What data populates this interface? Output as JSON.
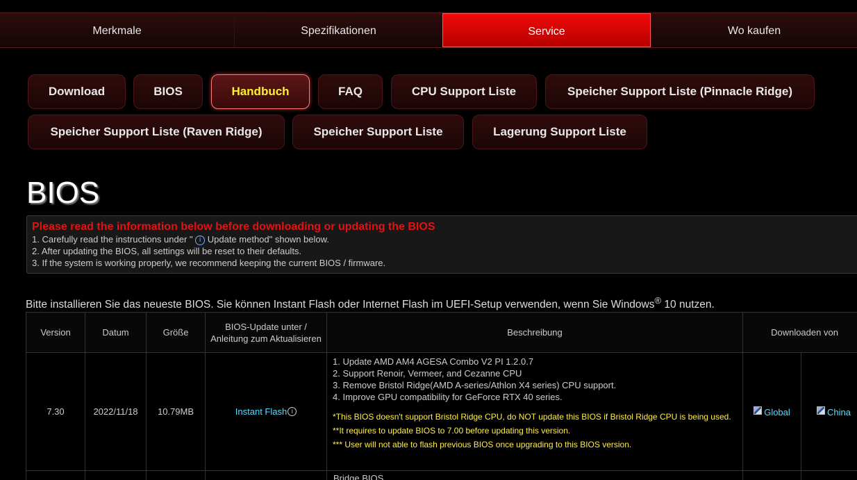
{
  "topnav": {
    "tabs": [
      {
        "label": "Merkmale"
      },
      {
        "label": "Spezifikationen"
      },
      {
        "label": "Service"
      },
      {
        "label": "Wo kaufen"
      }
    ]
  },
  "subnav": {
    "buttons": [
      {
        "label": "Download"
      },
      {
        "label": "BIOS"
      },
      {
        "label": "Handbuch"
      },
      {
        "label": "FAQ"
      },
      {
        "label": "CPU Support Liste"
      },
      {
        "label": "Speicher Support Liste (Pinnacle Ridge)"
      },
      {
        "label": "Speicher Support Liste (Raven Ridge)"
      },
      {
        "label": "Speicher Support Liste"
      },
      {
        "label": "Lagerung Support Liste"
      }
    ]
  },
  "page": {
    "title": "BIOS"
  },
  "notice": {
    "warning": "Please read the information below before downloading or updating the BIOS",
    "line1_pre": "1. Carefully read the instructions under \" ",
    "line1_icon": "i",
    "line1_post": " Update method\" shown below.",
    "line2": "2. After updating the BIOS, all settings will be reset to their defaults.",
    "line3": "3. If the system is working properly, we recommend keeping the current BIOS / firmware."
  },
  "intro": {
    "text_pre": "Bitte installieren Sie das neueste BIOS. Sie können Instant Flash oder Internet Flash im UEFI-Setup verwenden, wenn Sie Windows",
    "sup": "®",
    "text_post": " 10 nutzen."
  },
  "table": {
    "headers": {
      "version": "Version",
      "date": "Datum",
      "size": "Größe",
      "update": "BIOS-Update unter / Anleitung zum Aktualisieren",
      "description": "Beschreibung",
      "download": "Downloaden von"
    },
    "rows": [
      {
        "version": "7.30",
        "date": "2022/11/18",
        "size": "10.79MB",
        "update_link": "Instant Flash",
        "update_icon": "i",
        "desc": [
          "1. Update AMD AM4 AGESA Combo V2 PI 1.2.0.7",
          "2. Support Renoir, Vermeer, and Cezanne CPU",
          "3. Remove Bristol Ridge(AMD A-series/Athlon X4 series) CPU support.",
          "4. Improve GPU compatibility for GeForce RTX 40 series."
        ],
        "notes": [
          "*This BIOS doesn't support Bristol Ridge CPU, do NOT update this BIOS if Bristol Ridge CPU is being used.",
          "**It requires to update BIOS to 7.00 before updating this version.",
          "*** User will not able to flash previous BIOS once upgrading to this BIOS version."
        ],
        "download_global": "Global",
        "download_china": "China"
      }
    ],
    "next_row_partial": "Bridge BIOS"
  },
  "colors": {
    "accent_red": "#e81010",
    "active_tab": "#d40000",
    "highlight_yellow": "#ffee33",
    "link_cyan": "#55ddff"
  }
}
